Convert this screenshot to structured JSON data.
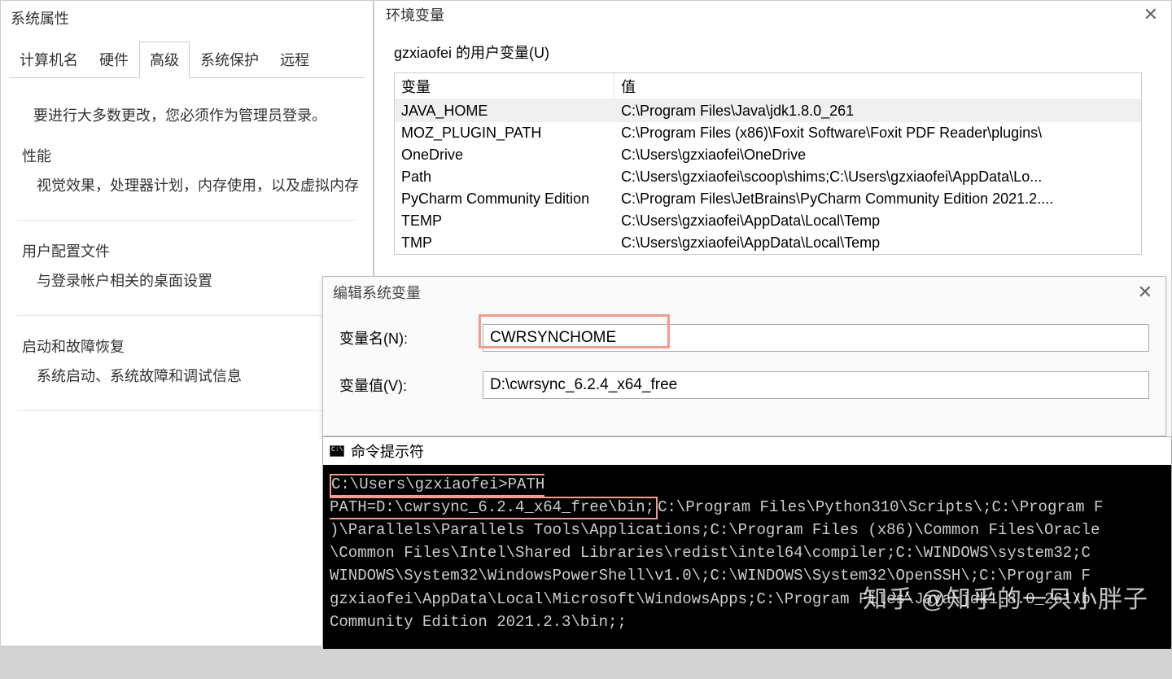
{
  "sysProps": {
    "title": "系统属性",
    "tabs": [
      "计算机名",
      "硬件",
      "高级",
      "系统保护",
      "远程"
    ],
    "activeTab": 2,
    "adminNote": "要进行大多数更改，您必须作为管理员登录。",
    "perfLabel": "性能",
    "perfText": "视觉效果，处理器计划，内存使用，以及虚拟内存",
    "userProfLabel": "用户配置文件",
    "userProfText": "与登录帐户相关的桌面设置",
    "startupLabel": "启动和故障恢复",
    "startupText": "系统启动、系统故障和调试信息"
  },
  "envDialog": {
    "title": "环境变量",
    "userVarsLabel": "gzxiaofei 的用户变量(U)",
    "headVar": "变量",
    "headVal": "值",
    "rows": [
      {
        "name": "JAVA_HOME",
        "value": "C:\\Program Files\\Java\\jdk1.8.0_261"
      },
      {
        "name": "MOZ_PLUGIN_PATH",
        "value": "C:\\Program Files (x86)\\Foxit Software\\Foxit PDF Reader\\plugins\\"
      },
      {
        "name": "OneDrive",
        "value": "C:\\Users\\gzxiaofei\\OneDrive"
      },
      {
        "name": "Path",
        "value": "C:\\Users\\gzxiaofei\\scoop\\shims;C:\\Users\\gzxiaofei\\AppData\\Lo..."
      },
      {
        "name": "PyCharm Community Edition",
        "value": "C:\\Program Files\\JetBrains\\PyCharm Community Edition 2021.2...."
      },
      {
        "name": "TEMP",
        "value": "C:\\Users\\gzxiaofei\\AppData\\Local\\Temp"
      },
      {
        "name": "TMP",
        "value": "C:\\Users\\gzxiaofei\\AppData\\Local\\Temp"
      }
    ]
  },
  "editDialog": {
    "title": "编辑系统变量",
    "nameLabel": "变量名(N):",
    "valueLabel": "变量值(V):",
    "nameValue": "CWRSYNCHOME",
    "valueValue": "D:\\cwrsync_6.2.4_x64_free"
  },
  "cmd": {
    "title": "命令提示符",
    "prompt": "C:\\Users\\gzxiaofei>PATH",
    "pathPrefix": "PATH=D:\\cwrsync_6.2.4_x64_free\\bin;",
    "rest": "C:\\Program Files\\Python310\\Scripts\\;C:\\Program F\n)\\Parallels\\Parallels Tools\\Applications;C:\\Program Files (x86)\\Common Files\\Oracle\n\\Common Files\\Intel\\Shared Libraries\\redist\\intel64\\compiler;C:\\WINDOWS\\system32;C\nWINDOWS\\System32\\WindowsPowerShell\\v1.0\\;C:\\WINDOWS\\System32\\OpenSSH\\;C:\\Program F\ngzxiaofei\\AppData\\Local\\Microsoft\\WindowsApps;C:\\Program Files\\Java\\jdk1.8.0_261\\b\nCommunity Edition 2021.2.3\\bin;;"
  },
  "watermark": "知乎 @知乎的一只小胖子"
}
